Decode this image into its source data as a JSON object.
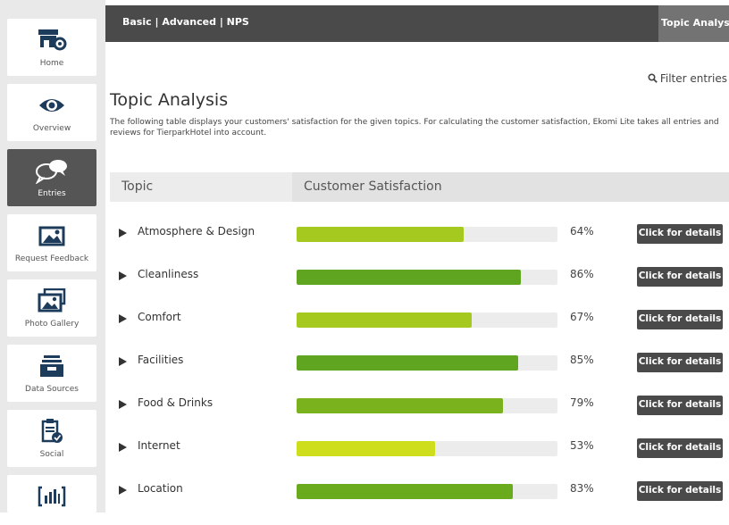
{
  "sidebar": {
    "items": [
      {
        "label": "Home",
        "icon": "storefront-icon",
        "active": false
      },
      {
        "label": "Overview",
        "icon": "eye-icon",
        "active": false
      },
      {
        "label": "Entries",
        "icon": "chat-bubbles-icon",
        "active": true
      },
      {
        "label": "Request Feedback",
        "icon": "picture-icon",
        "active": false
      },
      {
        "label": "Photo Gallery",
        "icon": "pictures-icon",
        "active": false
      },
      {
        "label": "Data Sources",
        "icon": "inbox-icon",
        "active": false
      },
      {
        "label": "Social",
        "icon": "clipboard-check-icon",
        "active": false
      },
      {
        "label": "",
        "icon": "bar-chart-icon",
        "active": false
      }
    ]
  },
  "topbar": {
    "links": "Basic | Advanced | NPS",
    "current": "Topic Analysis"
  },
  "filter_label": "Filter entries",
  "page_title": "Topic Analysis",
  "description": "The following table displays your customers' satisfaction for the given topics. For calculating the customer satisfaction, Ekomi Lite takes all entries and reviews for TierparkHotel into account.",
  "table": {
    "col_topic": "Topic",
    "col_satisfaction": "Customer Satisfaction",
    "details_label": "Click for details",
    "rows": [
      {
        "topic": "Atmosphere & Design",
        "value": 64,
        "pct_label": "64%",
        "color": "#a5c91e"
      },
      {
        "topic": "Cleanliness",
        "value": 86,
        "pct_label": "86%",
        "color": "#5fa51f"
      },
      {
        "topic": "Comfort",
        "value": 67,
        "pct_label": "67%",
        "color": "#a5c91e"
      },
      {
        "topic": "Facilities",
        "value": 85,
        "pct_label": "85%",
        "color": "#5fa51f"
      },
      {
        "topic": "Food & Drinks",
        "value": 79,
        "pct_label": "79%",
        "color": "#79b21c"
      },
      {
        "topic": "Internet",
        "value": 53,
        "pct_label": "53%",
        "color": "#cfde1c"
      },
      {
        "topic": "Location",
        "value": 83,
        "pct_label": "83%",
        "color": "#6aab1e"
      }
    ]
  },
  "colors": {
    "sidebar_bg": "#e9e9e9",
    "active_nav": "#555555",
    "topbar": "#4a4a4a",
    "icon_blue": "#1d3b5a"
  }
}
